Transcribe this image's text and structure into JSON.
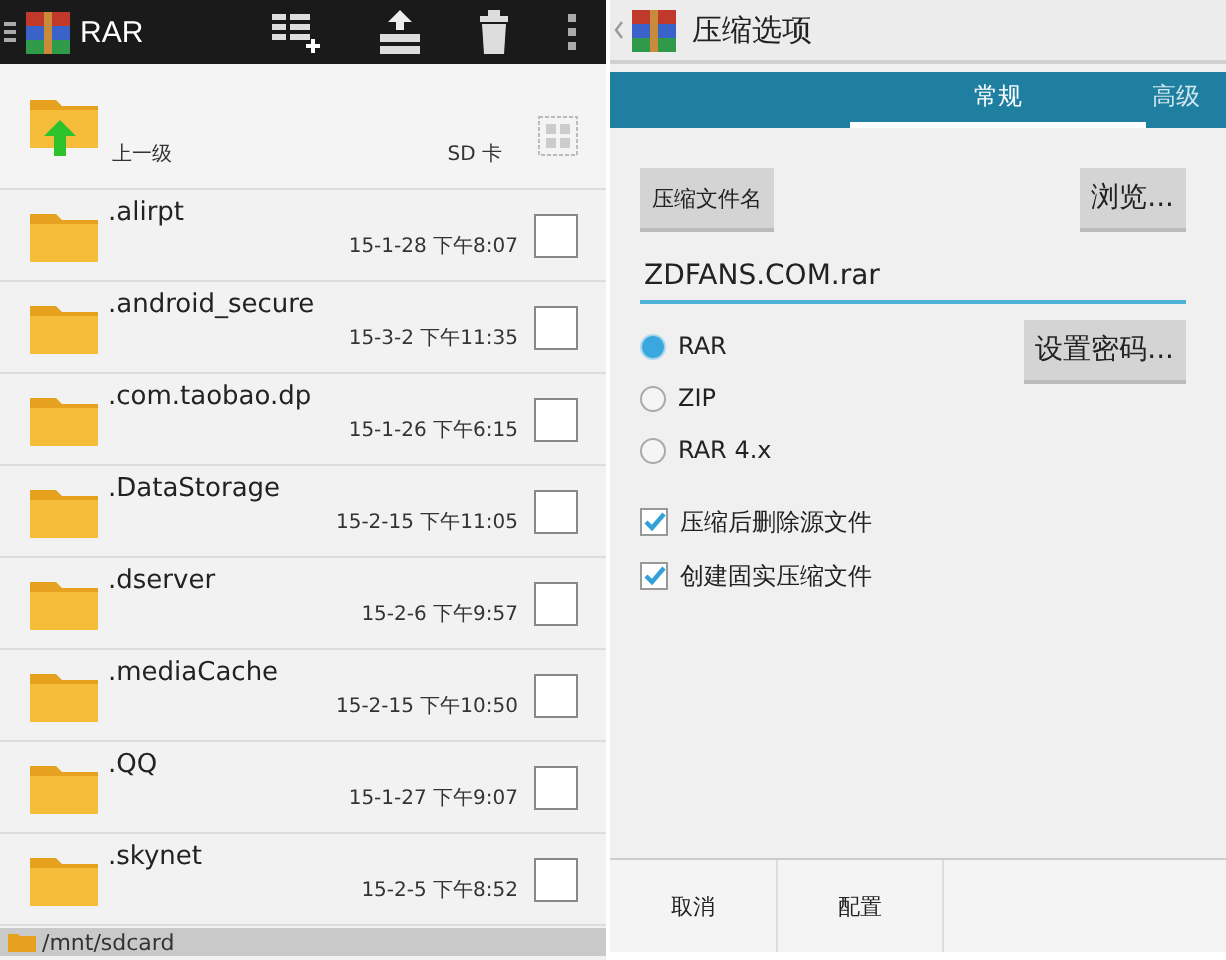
{
  "file_browser": {
    "app_title": "RAR",
    "parent": {
      "label": "上一级",
      "storage": "SD 卡"
    },
    "files": [
      {
        "name": ".alirpt",
        "date": "15-1-28 下午8:07",
        "checked": false
      },
      {
        "name": ".android_secure",
        "date": "15-3-2 下午11:35",
        "checked": false
      },
      {
        "name": ".com.taobao.dp",
        "date": "15-1-26 下午6:15",
        "checked": false
      },
      {
        "name": ".DataStorage",
        "date": "15-2-15 下午11:05",
        "checked": false
      },
      {
        "name": ".dserver",
        "date": "15-2-6 下午9:57",
        "checked": false
      },
      {
        "name": ".mediaCache",
        "date": "15-2-15 下午10:50",
        "checked": false
      },
      {
        "name": ".QQ",
        "date": "15-1-27 下午9:07",
        "checked": false
      },
      {
        "name": ".skynet",
        "date": "15-2-5 下午8:52",
        "checked": false
      }
    ],
    "path": "/mnt/sdcard"
  },
  "options": {
    "title": "压缩选项",
    "tabs": [
      {
        "label": "常规",
        "selected": true
      },
      {
        "label": "高级",
        "selected": false
      }
    ],
    "archive_name_button": "压缩文件名",
    "browse_button": "浏览...",
    "archive_name": "ZDFANS.COM.rar",
    "formats": [
      {
        "label": "RAR",
        "selected": true
      },
      {
        "label": "ZIP",
        "selected": false
      },
      {
        "label": "RAR 4.x",
        "selected": false
      }
    ],
    "password_button": "设置密码...",
    "checkboxes": [
      {
        "label": "压缩后删除源文件",
        "checked": true
      },
      {
        "label": "创建固实压缩文件",
        "checked": true
      }
    ],
    "buttons": [
      "取消",
      "配置"
    ]
  }
}
